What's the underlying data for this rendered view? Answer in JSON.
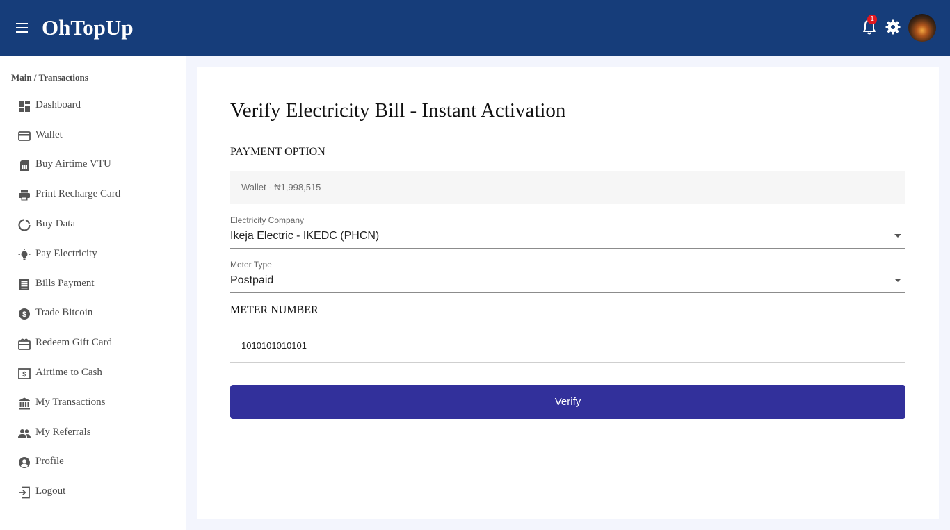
{
  "app": {
    "brand": "OhTopUp",
    "notification_count": "1"
  },
  "sidebar": {
    "breadcrumb": "Main / Transactions",
    "items": [
      {
        "label": "Dashboard",
        "icon": "dashboard-icon"
      },
      {
        "label": "Wallet",
        "icon": "credit-card-icon"
      },
      {
        "label": "Buy Airtime VTU",
        "icon": "sim-card-icon"
      },
      {
        "label": "Print Recharge Card",
        "icon": "printer-icon"
      },
      {
        "label": "Buy Data",
        "icon": "data-usage-icon"
      },
      {
        "label": "Pay Electricity",
        "icon": "light-bulb-icon"
      },
      {
        "label": "Bills Payment",
        "icon": "receipt-icon"
      },
      {
        "label": "Trade Bitcoin",
        "icon": "dollar-coin-icon"
      },
      {
        "label": "Redeem Gift Card",
        "icon": "gift-card-icon"
      },
      {
        "label": "Airtime to Cash",
        "icon": "money-icon"
      },
      {
        "label": "My Transactions",
        "icon": "bank-icon"
      },
      {
        "label": "My Referrals",
        "icon": "people-icon"
      },
      {
        "label": "Profile",
        "icon": "account-circle-icon"
      },
      {
        "label": "Logout",
        "icon": "logout-icon"
      }
    ]
  },
  "main": {
    "title": "Verify Electricity Bill - Instant Activation",
    "payment_option_label": "PAYMENT OPTION",
    "payment_value": "Wallet - ₦1,998,515",
    "company": {
      "label": "Electricity Company",
      "value": "Ikeja Electric - IKEDC (PHCN)"
    },
    "meter_type": {
      "label": "Meter Type",
      "value": "Postpaid"
    },
    "meter_number_label": "METER NUMBER",
    "meter_number_value": "1010101010101",
    "verify_label": "Verify"
  },
  "colors": {
    "appbar": "#163d7a",
    "button": "#32309b",
    "content_bg": "#f3f5fd",
    "badge": "#e3171e"
  }
}
